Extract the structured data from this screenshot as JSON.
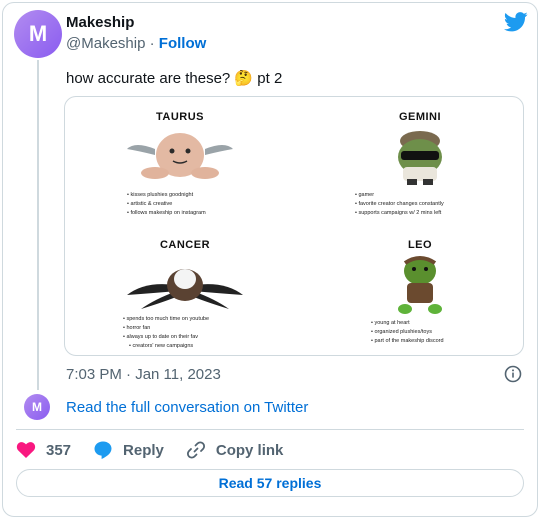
{
  "account": {
    "avatar_letter": "M",
    "name": "Makeship",
    "handle": "@Makeship",
    "separator": "·",
    "follow_label": "Follow",
    "brand_color": "#8a5cf0"
  },
  "tweet": {
    "text": "how accurate are these? 🤔 pt 2",
    "timestamp": "7:03 PM · Jan 11, 2023"
  },
  "media": {
    "signs": [
      {
        "title": "TAURUS",
        "bullets": [
          "kisses plushies goodnight",
          "artistic & creative",
          "follows makeship on instagram"
        ]
      },
      {
        "title": "GEMINI",
        "bullets": [
          "gamer",
          "favorite creator changes constantly",
          "supports campaigns w/ 2 mins left"
        ]
      },
      {
        "title": "CANCER",
        "bullets": [
          "spends too much time on youtube",
          "horror fan",
          "always up to date on their fav",
          "creators' new campaigns"
        ]
      },
      {
        "title": "LEO",
        "bullets": [
          "young at heart",
          "organized plushies/toys",
          "part of the makeship discord"
        ]
      }
    ]
  },
  "conversation": {
    "avatar_letter": "M",
    "link_label": "Read the full conversation on Twitter"
  },
  "actions": {
    "like_count": "357",
    "reply_label": "Reply",
    "copy_label": "Copy link"
  },
  "footer": {
    "read_replies_label": "Read 57 replies"
  },
  "colors": {
    "link": "#006fd6",
    "like": "#f91880",
    "reply": "#1d9bf0",
    "twitter": "#1d9bf0",
    "muted": "#536471",
    "border": "#cfd9de"
  }
}
